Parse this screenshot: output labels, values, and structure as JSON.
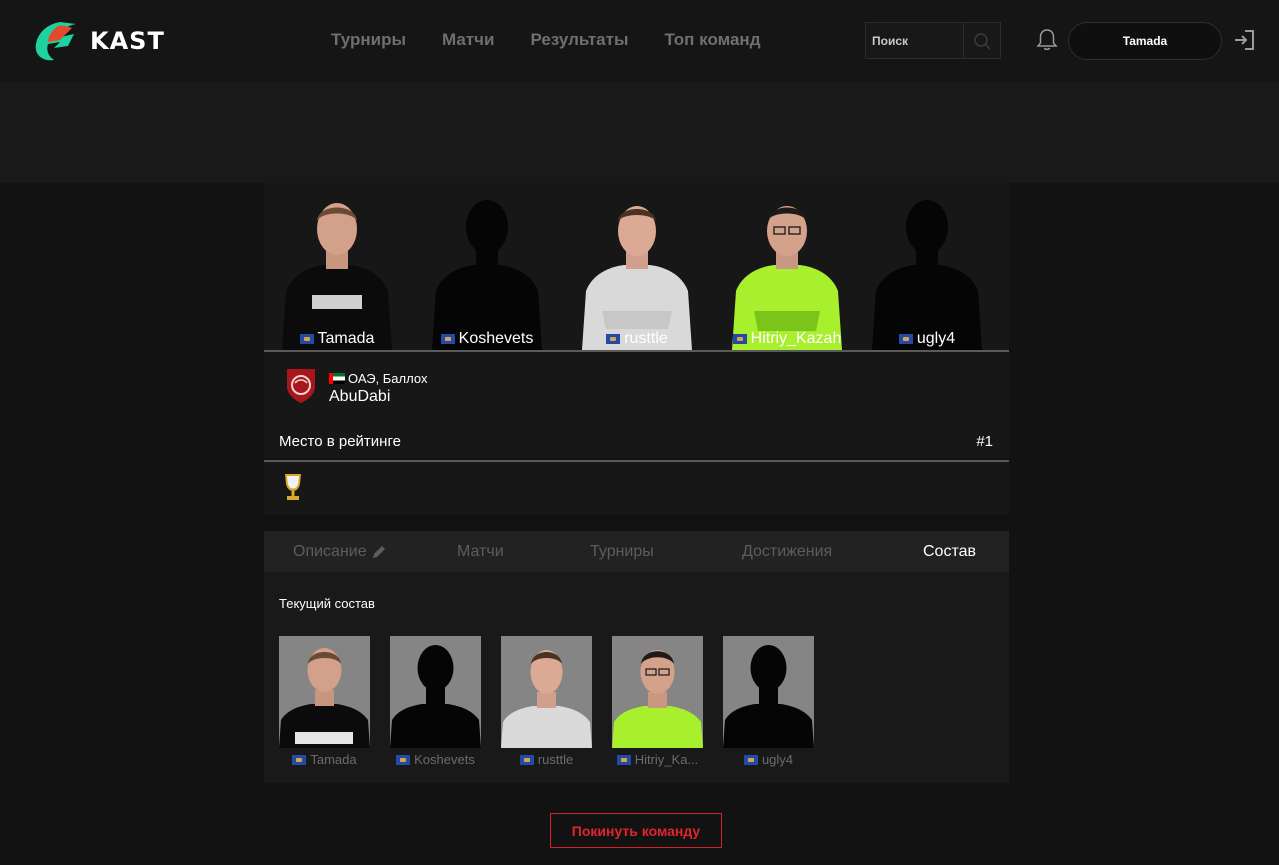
{
  "brand": {
    "name": "KAST"
  },
  "nav": [
    {
      "label": "Турниры"
    },
    {
      "label": "Матчи"
    },
    {
      "label": "Результаты"
    },
    {
      "label": "Топ команд"
    }
  ],
  "search": {
    "placeholder": "Поиск"
  },
  "user": {
    "name": "Tamada"
  },
  "hero_players": [
    {
      "name": "Tamada",
      "shirt": "#0b0b0b",
      "photo": true
    },
    {
      "name": "Koshevets",
      "shirt": "#050505",
      "photo": false
    },
    {
      "name": "rusttle",
      "shirt": "#d9d9d9",
      "photo": true
    },
    {
      "name": "Hitriy_Kazah",
      "shirt": "#a8ef2d",
      "photo": true
    },
    {
      "name": "ugly4",
      "shirt": "#050505",
      "photo": false
    }
  ],
  "team": {
    "location": "ОАЭ, Баллох",
    "name": "AbuDabi",
    "rank_label": "Место в рейтинге",
    "rank_value": "#1"
  },
  "tabs": [
    {
      "label": "Описание",
      "active": false
    },
    {
      "label": "Матчи",
      "active": false
    },
    {
      "label": "Турниры",
      "active": false
    },
    {
      "label": "Достижения",
      "active": false
    },
    {
      "label": "Состав",
      "active": true
    }
  ],
  "roster": {
    "title": "Текущий состав",
    "players": [
      {
        "name": "Tamada"
      },
      {
        "name": "Koshevets"
      },
      {
        "name": "rusttle"
      },
      {
        "name": "Hitriy_Ka..."
      },
      {
        "name": "ugly4"
      }
    ]
  },
  "leave_button": {
    "label": "Покинуть команду"
  },
  "colors": {
    "accent_green": "#1fd0a0",
    "accent_red": "#e0262c",
    "trophy_gold": "#d8a72b"
  }
}
